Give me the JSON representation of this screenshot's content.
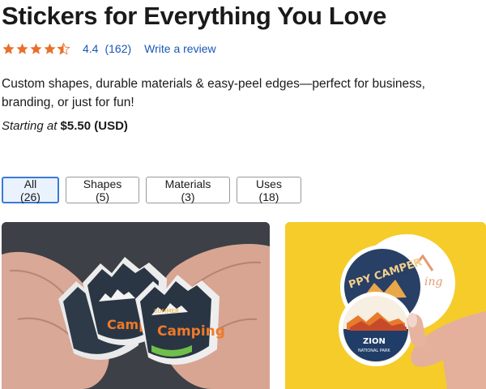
{
  "page": {
    "title": "Stickers for Everything You Love",
    "description": "Custom shapes, durable materials & easy-peel edges—perfect for business, branding, or just for fun!",
    "price_prefix": "Starting at",
    "price": "$5.50 (USD)"
  },
  "rating": {
    "value": "4.4",
    "stars": 4.4,
    "count": "(162)",
    "write_review": "Write a review"
  },
  "filters": [
    {
      "label": "All (26)",
      "selected": true
    },
    {
      "label": "Shapes (5)",
      "selected": false
    },
    {
      "label": "Materials (3)",
      "selected": false
    },
    {
      "label": "Uses (18)",
      "selected": false
    }
  ],
  "colors": {
    "star": "#e8702a",
    "link": "#1a56b8",
    "selected_border": "#3a7bd5",
    "selected_bg": "#eaf2fd"
  },
  "products": {
    "camping": {
      "sticker_text": "Camping",
      "sticker_small_text": "SUMMER"
    },
    "happy_camper": {
      "sticker_text": "PPY CAMPER",
      "sticker_small_text": "ZION",
      "sticker_small_subtext": "NATIONAL PARK"
    }
  }
}
